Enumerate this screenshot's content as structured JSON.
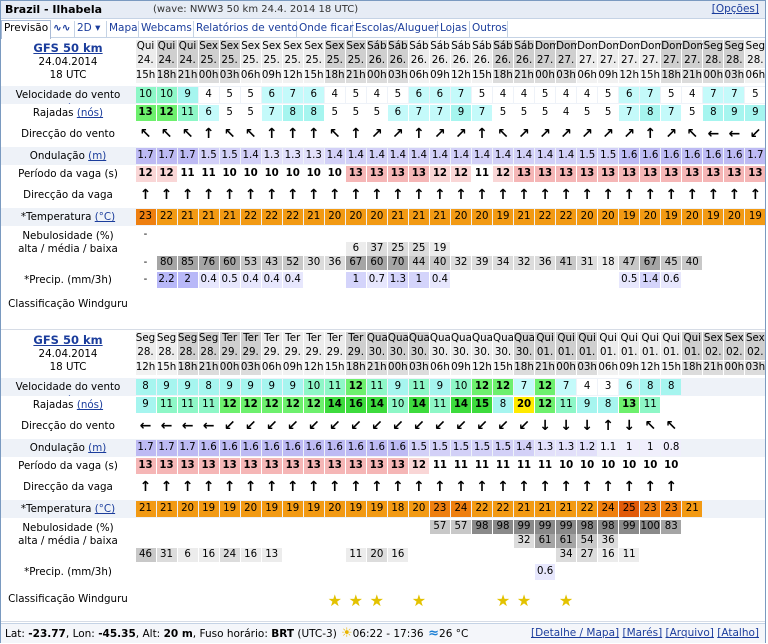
{
  "title": "Brazil - Ilhabela",
  "wave_note": "(wave: NWW3 50 km 24.4. 2014 18 UTC)",
  "options_link": "[Opções]",
  "tabs": [
    "Previsão",
    "∿∿",
    "2D ▾",
    "Mapa",
    "Webcams",
    "Relatórios de vento",
    "Onde ficar",
    "Escolas/Aluguer",
    "Lojas",
    "Outros"
  ],
  "labels": {
    "velocidade": "Velocidade do vento",
    "velocidade_unit": "(nós)",
    "rajadas": "Rajadas",
    "rajadas_unit": "(nós)",
    "direccao_vento": "Direcção do vento",
    "ondulacao": "Ondulação",
    "ondulacao_unit": "(m)",
    "periodo": "Período da vaga (s)",
    "direccao_vaga": "Direcção da vaga",
    "temperatura": "*Temperatura",
    "temperatura_unit": "(°C)",
    "nebulosidade": "Nebulosidade (%)",
    "nebulosidade_sub": "alta / média / baixa",
    "precip": "*Precip. (mm/3h)",
    "classificacao": "Classificação Windguru"
  },
  "blocks": [
    {
      "model": "GFS 50 km",
      "date": "24.04.2014",
      "time": "18 UTC",
      "days": [
        "Qui",
        "Qui",
        "Qui",
        "Sex",
        "Sex",
        "Sex",
        "Sex",
        "Sex",
        "Sex",
        "Sex",
        "Sex",
        "Sáb",
        "Sáb",
        "Sáb",
        "Sáb",
        "Sáb",
        "Sáb",
        "Sáb",
        "Sáb",
        "Dom",
        "Dom",
        "Dom",
        "Dom",
        "Dom",
        "Dom",
        "Dom",
        "Dom",
        "Seg",
        "Seg",
        "Seg"
      ],
      "dates": [
        "24.",
        "24.",
        "24.",
        "25.",
        "25.",
        "25.",
        "25.",
        "25.",
        "25.",
        "25.",
        "25.",
        "26.",
        "26.",
        "26.",
        "26.",
        "26.",
        "26.",
        "26.",
        "26.",
        "27.",
        "27.",
        "27.",
        "27.",
        "27.",
        "27.",
        "27.",
        "27.",
        "28.",
        "28.",
        "28."
      ],
      "hours": [
        "15h",
        "18h",
        "21h",
        "00h",
        "03h",
        "06h",
        "09h",
        "12h",
        "15h",
        "18h",
        "21h",
        "00h",
        "03h",
        "06h",
        "09h",
        "12h",
        "15h",
        "18h",
        "21h",
        "00h",
        "03h",
        "06h",
        "09h",
        "12h",
        "15h",
        "18h",
        "21h",
        "00h",
        "03h",
        "06h"
      ],
      "wind": [
        "10",
        "10",
        "9",
        "4",
        "5",
        "5",
        "6",
        "7",
        "6",
        "4",
        "5",
        "4",
        "5",
        "6",
        "6",
        "7",
        "5",
        "4",
        "4",
        "5",
        "4",
        "4",
        "5",
        "6",
        "7",
        "5",
        "4",
        "7",
        "7",
        "5"
      ],
      "gusts": [
        "13",
        "12",
        "11",
        "6",
        "5",
        "5",
        "7",
        "8",
        "8",
        "5",
        "5",
        "5",
        "6",
        "7",
        "7",
        "9",
        "7",
        "5",
        "5",
        "5",
        "4",
        "5",
        "5",
        "7",
        "8",
        "7",
        "5",
        "8",
        "9",
        "9"
      ],
      "wind_dir": [
        "↖",
        "↖",
        "↖",
        "↑",
        "↖",
        "↖",
        "↑",
        "↑",
        "↑",
        "↖",
        "↑",
        "↗",
        "↗",
        "↑",
        "↗",
        "↗",
        "↑",
        "↖",
        "↗",
        "↗",
        "↗",
        "↗",
        "↗",
        "↗",
        "↑",
        "↗",
        "↖",
        "←",
        "←",
        "↙"
      ],
      "swell": [
        "1.7",
        "1.7",
        "1.7",
        "1.5",
        "1.5",
        "1.4",
        "1.3",
        "1.3",
        "1.3",
        "1.4",
        "1.4",
        "1.4",
        "1.4",
        "1.4",
        "1.4",
        "1.4",
        "1.4",
        "1.4",
        "1.4",
        "1.4",
        "1.4",
        "1.5",
        "1.5",
        "1.6",
        "1.6",
        "1.6",
        "1.6",
        "1.6",
        "1.6",
        "1.7"
      ],
      "period": [
        "12",
        "12",
        "11",
        "11",
        "10",
        "10",
        "10",
        "10",
        "10",
        "10",
        "13",
        "13",
        "13",
        "13",
        "12",
        "12",
        "11",
        "12",
        "13",
        "13",
        "13",
        "13",
        "13",
        "13",
        "13",
        "13",
        "13",
        "13",
        "13",
        "13"
      ],
      "wave_dir": [
        "↑",
        "↑",
        "↑",
        "↑",
        "↑",
        "↑",
        "↑",
        "↑",
        "↑",
        "↑",
        "↑",
        "↑",
        "↑",
        "↑",
        "↑",
        "↑",
        "↑",
        "↑",
        "↑",
        "↑",
        "↑",
        "↑",
        "↑",
        "↑",
        "↑",
        "↑",
        "↑",
        "↑",
        "↑",
        "↑"
      ],
      "temp": [
        "23",
        "22",
        "21",
        "21",
        "21",
        "22",
        "22",
        "22",
        "21",
        "20",
        "20",
        "20",
        "21",
        "21",
        "21",
        "20",
        "20",
        "19",
        "21",
        "22",
        "22",
        "20",
        "20",
        "19",
        "20",
        "19",
        "20",
        "19",
        "20",
        "19"
      ],
      "cloud_high": [
        "-",
        "",
        "",
        "",
        "",
        "",
        "",
        "",
        "",
        "",
        "",
        "",
        "",
        "",
        "",
        "",
        "",
        "",
        "",
        "",
        "",
        "",
        "",
        "",
        "",
        "",
        "",
        "",
        "",
        ""
      ],
      "cloud_mid": [
        "",
        "",
        "",
        "",
        "",
        "",
        "",
        "",
        "",
        "",
        "6",
        "37",
        "25",
        "25",
        "19",
        "",
        "",
        "",
        "",
        "",
        "",
        "",
        "",
        "",
        "",
        "",
        "",
        "",
        "",
        ""
      ],
      "cloud_low": [
        "-",
        "80",
        "85",
        "76",
        "60",
        "53",
        "43",
        "52",
        "30",
        "36",
        "67",
        "60",
        "70",
        "44",
        "40",
        "32",
        "39",
        "34",
        "32",
        "36",
        "41",
        "31",
        "18",
        "47",
        "67",
        "45",
        "40",
        "",
        "",
        ""
      ],
      "precip": [
        "-",
        "2.2",
        "2",
        "0.4",
        "0.5",
        "0.4",
        "0.4",
        "0.4",
        "",
        "",
        "1",
        "0.7",
        "1.3",
        "1",
        "0.4",
        "",
        "",
        "",
        "",
        "",
        "",
        "",
        "",
        "0.5",
        "1.4",
        "0.6",
        "",
        "",
        "",
        ""
      ],
      "stars": [
        0,
        0,
        0,
        0,
        0,
        0,
        0,
        0,
        0,
        0,
        0,
        0,
        0,
        0,
        0,
        0,
        0,
        0,
        0,
        0,
        0,
        0,
        0,
        0,
        0,
        0,
        0,
        0,
        0,
        0
      ]
    },
    {
      "model": "GFS 50 km",
      "date": "24.04.2014",
      "time": "18 UTC",
      "days": [
        "Seg",
        "Seg",
        "Seg",
        "Seg",
        "Ter",
        "Ter",
        "Ter",
        "Ter",
        "Ter",
        "Ter",
        "Ter",
        "Qua",
        "Qua",
        "Qua",
        "Qua",
        "Qua",
        "Qua",
        "Qua",
        "Qua",
        "Qui",
        "Qui",
        "Qui",
        "Qui",
        "Qui",
        "Qui",
        "Qui",
        "Qui",
        "Sex",
        "Sex",
        "Sex"
      ],
      "dates": [
        "28.",
        "28.",
        "28.",
        "28.",
        "29.",
        "29.",
        "29.",
        "29.",
        "29.",
        "29.",
        "29.",
        "30.",
        "30.",
        "30.",
        "30.",
        "30.",
        "30.",
        "30.",
        "30.",
        "01.",
        "01.",
        "01.",
        "01.",
        "01.",
        "01.",
        "01.",
        "01.",
        "02.",
        "02.",
        "02."
      ],
      "hours": [
        "12h",
        "15h",
        "18h",
        "21h",
        "00h",
        "03h",
        "06h",
        "09h",
        "12h",
        "15h",
        "18h",
        "21h",
        "00h",
        "03h",
        "06h",
        "09h",
        "12h",
        "15h",
        "18h",
        "21h",
        "00h",
        "03h",
        "06h",
        "09h",
        "12h",
        "15h",
        "18h",
        "21h",
        "00h",
        "03h"
      ],
      "wind": [
        "8",
        "9",
        "9",
        "8",
        "9",
        "9",
        "9",
        "9",
        "10",
        "11",
        "12",
        "11",
        "9",
        "11",
        "9",
        "10",
        "12",
        "12",
        "7",
        "12",
        "7",
        "4",
        "3",
        "6",
        "8",
        "8",
        "",
        "",
        "",
        ""
      ],
      "gusts": [
        "9",
        "11",
        "11",
        "11",
        "12",
        "12",
        "12",
        "12",
        "12",
        "14",
        "16",
        "14",
        "10",
        "14",
        "11",
        "14",
        "15",
        "8",
        "20",
        "12",
        "11",
        "9",
        "8",
        "13",
        "11",
        "",
        "",
        "",
        "",
        ""
      ],
      "wind_dir": [
        "←",
        "←",
        "←",
        "←",
        "↙",
        "↙",
        "↙",
        "↙",
        "↙",
        "↙",
        "↙",
        "↙",
        "↙",
        "↙",
        "↙",
        "↙",
        "↙",
        "↙",
        "↙",
        "↓",
        "↓",
        "↓",
        "↑",
        "↓",
        "↖",
        "↖",
        "",
        "",
        "",
        ""
      ],
      "swell": [
        "1.7",
        "1.7",
        "1.7",
        "1.6",
        "1.6",
        "1.6",
        "1.6",
        "1.6",
        "1.6",
        "1.6",
        "1.6",
        "1.6",
        "1.6",
        "1.5",
        "1.5",
        "1.5",
        "1.5",
        "1.5",
        "1.4",
        "1.3",
        "1.3",
        "1.2",
        "1.1",
        "1",
        "1",
        "0.8",
        "",
        "",
        "",
        ""
      ],
      "period": [
        "13",
        "13",
        "13",
        "13",
        "13",
        "13",
        "13",
        "13",
        "13",
        "13",
        "13",
        "13",
        "13",
        "12",
        "11",
        "11",
        "11",
        "11",
        "11",
        "11",
        "10",
        "10",
        "10",
        "10",
        "10",
        "10",
        "",
        "",
        "",
        ""
      ],
      "wave_dir": [
        "↑",
        "↑",
        "↑",
        "↑",
        "↑",
        "↑",
        "↑",
        "↑",
        "↑",
        "↑",
        "↑",
        "↑",
        "↑",
        "↑",
        "↑",
        "↑",
        "↑",
        "↑",
        "↑",
        "↑",
        "↑",
        "↑",
        "↑",
        "↑",
        "↑",
        "↑",
        "",
        "",
        "",
        ""
      ],
      "temp": [
        "21",
        "21",
        "20",
        "19",
        "19",
        "20",
        "19",
        "19",
        "19",
        "20",
        "19",
        "19",
        "18",
        "20",
        "23",
        "24",
        "22",
        "22",
        "21",
        "21",
        "21",
        "22",
        "24",
        "25",
        "23",
        "23",
        "21",
        "",
        "",
        ""
      ],
      "cloud_high": [
        "",
        "",
        "",
        "",
        "",
        "",
        "",
        "",
        "",
        "",
        "",
        "",
        "",
        "",
        "57",
        "57",
        "98",
        "98",
        "99",
        "99",
        "99",
        "98",
        "98",
        "99",
        "100",
        "83",
        "",
        "",
        "",
        ""
      ],
      "cloud_mid": [
        "",
        "",
        "",
        "",
        "",
        "",
        "",
        "",
        "",
        "",
        "",
        "",
        "",
        "",
        "",
        "",
        "",
        "",
        "32",
        "61",
        "61",
        "54",
        "36",
        "",
        "",
        "",
        "",
        "",
        "",
        ""
      ],
      "cloud_low": [
        "46",
        "31",
        "6",
        "16",
        "24",
        "16",
        "13",
        "",
        "",
        "",
        "11",
        "20",
        "16",
        "",
        "",
        "",
        "",
        "",
        "",
        "",
        "34",
        "27",
        "16",
        "11",
        "",
        "",
        "",
        "",
        "",
        ""
      ],
      "precip": [
        "",
        "",
        "",
        "",
        "",
        "",
        "",
        "",
        "",
        "",
        "",
        "",
        "",
        "",
        "",
        "",
        "",
        "",
        "",
        "0.6",
        "",
        "",
        "",
        "",
        "",
        "",
        "",
        "",
        "",
        ""
      ],
      "stars": [
        0,
        0,
        0,
        0,
        0,
        0,
        0,
        0,
        0,
        1,
        1,
        1,
        0,
        1,
        0,
        0,
        0,
        1,
        1,
        0,
        1,
        0,
        0,
        0,
        0,
        0,
        0,
        0,
        0,
        0
      ]
    }
  ],
  "footer": {
    "lat_label": "Lat:",
    "lat": "-23.77",
    "lon_label": "Lon:",
    "lon": "-45.35",
    "alt_label": "Alt:",
    "alt": "20 m",
    "tz_label": "Fuso horário:",
    "tz": "BRT",
    "tz_offset": "(UTC-3)",
    "sun": "06:22 - 17:36",
    "water_temp": "26 °C",
    "links": [
      "[Detalhe / Mapa]",
      "[Marés]",
      "[Arquivo]",
      "[Atalho]"
    ]
  },
  "colors": {
    "link": "#1b3d9c",
    "temp_orange": "#f08a00",
    "swell_purple": "#c9c5f5",
    "period_pink": "#f7c6c6"
  }
}
